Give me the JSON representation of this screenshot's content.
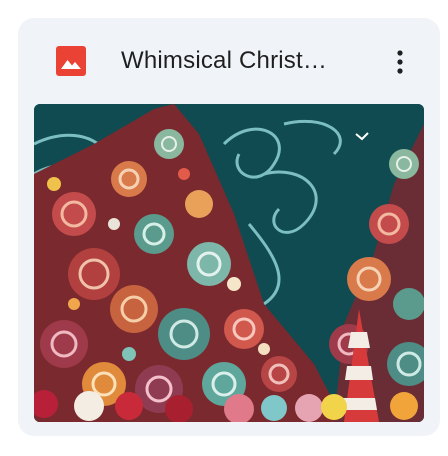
{
  "file_card": {
    "title": "Whimsical Christ…",
    "file_type_icon": "image-file-icon",
    "menu_icon": "more-vertical-icon",
    "thumbnail_icon": "thumbnail-image"
  },
  "colors": {
    "card_background": "#f0f4f9",
    "file_icon_red": "#ea4335",
    "title_text": "#1f1f1f",
    "thumbnail_background": "#0f4b50"
  }
}
